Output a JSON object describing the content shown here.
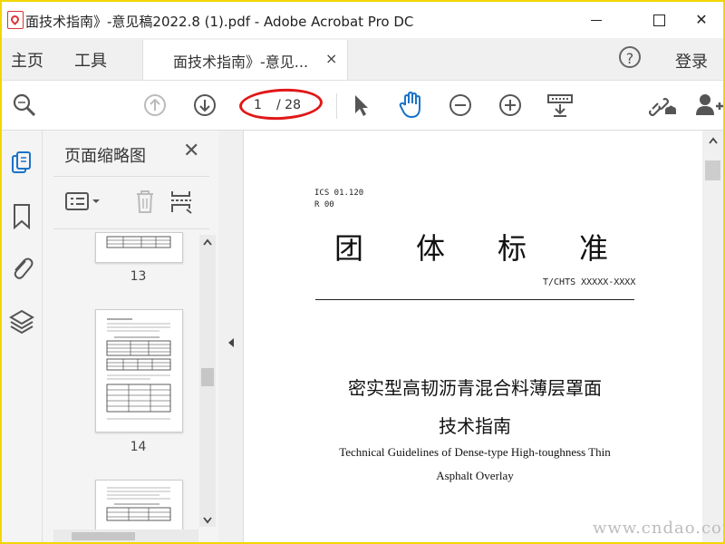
{
  "window": {
    "title": "面技术指南》-意见稿2022.8 (1).pdf - Adobe Acrobat Pro DC",
    "minimize": "—",
    "maximize": "☐",
    "close": "✕"
  },
  "menu": {
    "home": "主页",
    "tools": "工具",
    "doc_tab": "面技术指南》-意见...",
    "doc_tab_close": "×",
    "help": "?",
    "login": "登录"
  },
  "toolbar": {
    "current_page": "1",
    "total_pages": "/ 28"
  },
  "panel": {
    "title": "页面缩略图",
    "close": "✕",
    "thumbnails": [
      {
        "label": "13"
      },
      {
        "label": "14"
      }
    ]
  },
  "document": {
    "ics": "ICS 01.120",
    "r00": "R 00",
    "big_title": "团体标准",
    "standard_no": "T/CHTS XXXXX-XXXX",
    "cn_title_line1": "密实型高韧沥青混合料薄层罩面",
    "cn_title_line2": "技术指南",
    "en_title_line1": "Technical Guidelines of Dense-type High-toughness Thin",
    "en_title_line2": "Asphalt Overlay"
  },
  "watermark": "www.cndao.com",
  "colors": {
    "frame": "#f2d600",
    "hand_tool": "#1a73c8",
    "annotation_ellipse": "#e01818"
  }
}
